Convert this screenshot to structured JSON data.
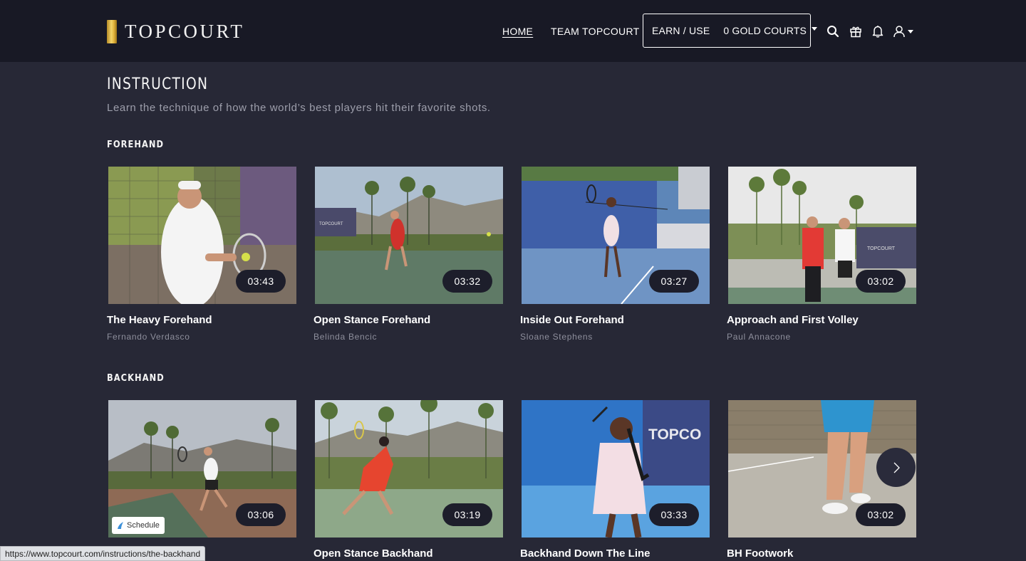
{
  "brand": {
    "name": "TOPCOURT"
  },
  "nav": {
    "home": "HOME",
    "team": "TEAM TOPCOURT",
    "earn_label": "EARN / USE",
    "gold_courts": "0 GOLD COURTS"
  },
  "icons": {
    "search": "search-icon",
    "gift": "gift-icon",
    "bell": "bell-icon",
    "user": "user-icon"
  },
  "page": {
    "title": "INSTRUCTION",
    "subtitle": "Learn the technique of how the world’s best players hit their favorite shots."
  },
  "sections": [
    {
      "title": "FOREHAND",
      "cards": [
        {
          "title": "The Heavy Forehand",
          "player": "Fernando Verdasco",
          "duration": "03:43"
        },
        {
          "title": "Open Stance Forehand",
          "player": "Belinda Bencic",
          "duration": "03:32"
        },
        {
          "title": "Inside Out Forehand",
          "player": "Sloane Stephens",
          "duration": "03:27"
        },
        {
          "title": "Approach and First Volley",
          "player": "Paul Annacone",
          "duration": "03:02"
        }
      ]
    },
    {
      "title": "BACKHAND",
      "cards": [
        {
          "title": "",
          "player": "",
          "duration": "03:06",
          "badge": "Schedule"
        },
        {
          "title": "Open Stance Backhand",
          "player": "",
          "duration": "03:19"
        },
        {
          "title": "Backhand Down The Line",
          "player": "",
          "duration": "03:33"
        },
        {
          "title": "BH Footwork",
          "player": "",
          "duration": "03:02"
        }
      ]
    }
  ],
  "thumb_text": {
    "banner": "TOPCOURT",
    "banner_partial": "TOPCO"
  },
  "status_bar": {
    "url": "https://www.topcourt.com/instructions/the-backhand"
  },
  "colors": {
    "background": "#272836",
    "nav_background": "#181925",
    "gold": "#e2b43c",
    "muted_text": "#8e8f9c"
  }
}
